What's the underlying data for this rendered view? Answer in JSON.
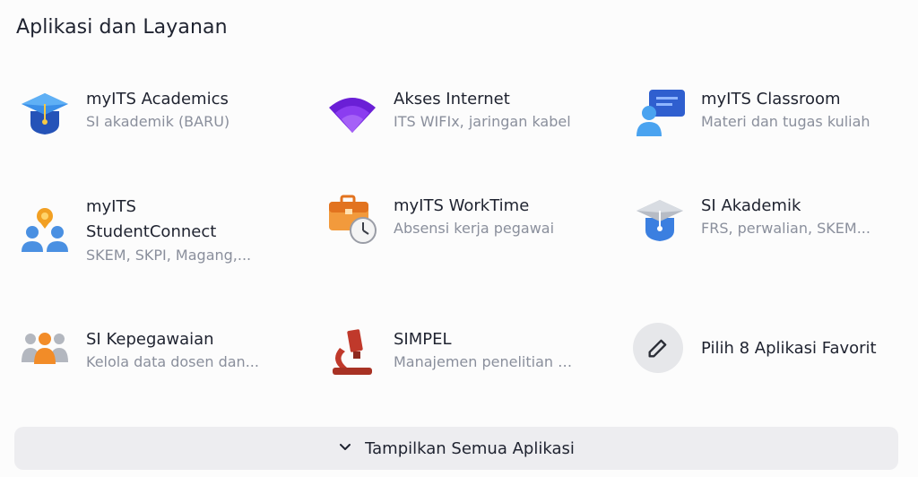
{
  "section": {
    "title": "Aplikasi dan Layanan"
  },
  "apps": [
    {
      "name": "myITS Academics",
      "desc": "SI akademik (BARU)",
      "icon": "graduation-cap-icon"
    },
    {
      "name": "Akses Internet",
      "desc": "ITS WIFIx, jaringan kabel",
      "icon": "wifi-icon"
    },
    {
      "name": "myITS Classroom",
      "desc": "Materi dan tugas kuliah",
      "icon": "classroom-icon"
    },
    {
      "name": "myITS StudentConnect",
      "desc": "SKEM, SKPI, Magang,...",
      "icon": "student-connect-icon"
    },
    {
      "name": "myITS WorkTime",
      "desc": "Absensi kerja pegawai",
      "icon": "briefcase-clock-icon"
    },
    {
      "name": "SI Akademik",
      "desc": "FRS, perwalian, SKEM...",
      "icon": "graduation-cap-icon"
    },
    {
      "name": "SI Kepegawaian",
      "desc": "Kelola data dosen dan...",
      "icon": "people-group-icon"
    },
    {
      "name": "SIMPEL",
      "desc": "Manajemen penelitian d...",
      "icon": "microscope-icon"
    }
  ],
  "favorite": {
    "label": "Pilih 8 Aplikasi Favorit",
    "icon": "edit-icon"
  },
  "show_all": {
    "label": "Tampilkan Semua Aplikasi",
    "icon": "chevron-down-icon"
  },
  "colors": {
    "accent_blue": "#2f6fd6",
    "accent_purple": "#7b2ff2",
    "accent_orange": "#f28c28",
    "accent_red": "#c0392b",
    "text_primary": "#1f2330",
    "text_secondary": "#8a8f9c",
    "button_bg": "#ededf0"
  }
}
